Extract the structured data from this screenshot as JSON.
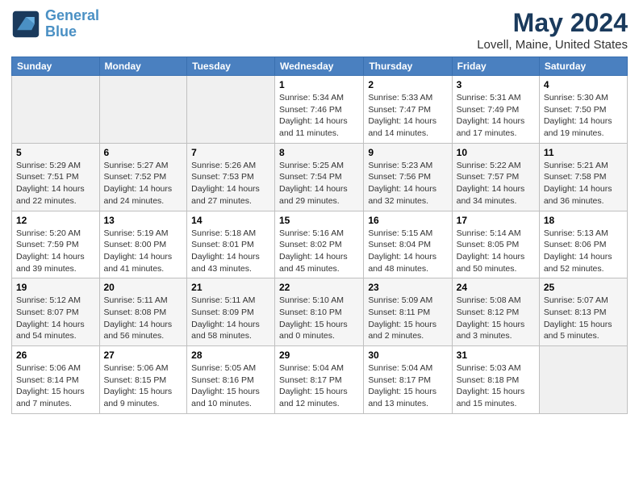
{
  "logo": {
    "line1": "General",
    "line2": "Blue"
  },
  "title": "May 2024",
  "location": "Lovell, Maine, United States",
  "weekdays": [
    "Sunday",
    "Monday",
    "Tuesday",
    "Wednesday",
    "Thursday",
    "Friday",
    "Saturday"
  ],
  "weeks": [
    [
      {
        "day": "",
        "empty": true
      },
      {
        "day": "",
        "empty": true
      },
      {
        "day": "",
        "empty": true
      },
      {
        "day": "1",
        "sunrise": "5:34 AM",
        "sunset": "7:46 PM",
        "daylight": "14 hours and 11 minutes."
      },
      {
        "day": "2",
        "sunrise": "5:33 AM",
        "sunset": "7:47 PM",
        "daylight": "14 hours and 14 minutes."
      },
      {
        "day": "3",
        "sunrise": "5:31 AM",
        "sunset": "7:49 PM",
        "daylight": "14 hours and 17 minutes."
      },
      {
        "day": "4",
        "sunrise": "5:30 AM",
        "sunset": "7:50 PM",
        "daylight": "14 hours and 19 minutes."
      }
    ],
    [
      {
        "day": "5",
        "sunrise": "5:29 AM",
        "sunset": "7:51 PM",
        "daylight": "14 hours and 22 minutes."
      },
      {
        "day": "6",
        "sunrise": "5:27 AM",
        "sunset": "7:52 PM",
        "daylight": "14 hours and 24 minutes."
      },
      {
        "day": "7",
        "sunrise": "5:26 AM",
        "sunset": "7:53 PM",
        "daylight": "14 hours and 27 minutes."
      },
      {
        "day": "8",
        "sunrise": "5:25 AM",
        "sunset": "7:54 PM",
        "daylight": "14 hours and 29 minutes."
      },
      {
        "day": "9",
        "sunrise": "5:23 AM",
        "sunset": "7:56 PM",
        "daylight": "14 hours and 32 minutes."
      },
      {
        "day": "10",
        "sunrise": "5:22 AM",
        "sunset": "7:57 PM",
        "daylight": "14 hours and 34 minutes."
      },
      {
        "day": "11",
        "sunrise": "5:21 AM",
        "sunset": "7:58 PM",
        "daylight": "14 hours and 36 minutes."
      }
    ],
    [
      {
        "day": "12",
        "sunrise": "5:20 AM",
        "sunset": "7:59 PM",
        "daylight": "14 hours and 39 minutes."
      },
      {
        "day": "13",
        "sunrise": "5:19 AM",
        "sunset": "8:00 PM",
        "daylight": "14 hours and 41 minutes."
      },
      {
        "day": "14",
        "sunrise": "5:18 AM",
        "sunset": "8:01 PM",
        "daylight": "14 hours and 43 minutes."
      },
      {
        "day": "15",
        "sunrise": "5:16 AM",
        "sunset": "8:02 PM",
        "daylight": "14 hours and 45 minutes."
      },
      {
        "day": "16",
        "sunrise": "5:15 AM",
        "sunset": "8:04 PM",
        "daylight": "14 hours and 48 minutes."
      },
      {
        "day": "17",
        "sunrise": "5:14 AM",
        "sunset": "8:05 PM",
        "daylight": "14 hours and 50 minutes."
      },
      {
        "day": "18",
        "sunrise": "5:13 AM",
        "sunset": "8:06 PM",
        "daylight": "14 hours and 52 minutes."
      }
    ],
    [
      {
        "day": "19",
        "sunrise": "5:12 AM",
        "sunset": "8:07 PM",
        "daylight": "14 hours and 54 minutes."
      },
      {
        "day": "20",
        "sunrise": "5:11 AM",
        "sunset": "8:08 PM",
        "daylight": "14 hours and 56 minutes."
      },
      {
        "day": "21",
        "sunrise": "5:11 AM",
        "sunset": "8:09 PM",
        "daylight": "14 hours and 58 minutes."
      },
      {
        "day": "22",
        "sunrise": "5:10 AM",
        "sunset": "8:10 PM",
        "daylight": "15 hours and 0 minutes."
      },
      {
        "day": "23",
        "sunrise": "5:09 AM",
        "sunset": "8:11 PM",
        "daylight": "15 hours and 2 minutes."
      },
      {
        "day": "24",
        "sunrise": "5:08 AM",
        "sunset": "8:12 PM",
        "daylight": "15 hours and 3 minutes."
      },
      {
        "day": "25",
        "sunrise": "5:07 AM",
        "sunset": "8:13 PM",
        "daylight": "15 hours and 5 minutes."
      }
    ],
    [
      {
        "day": "26",
        "sunrise": "5:06 AM",
        "sunset": "8:14 PM",
        "daylight": "15 hours and 7 minutes."
      },
      {
        "day": "27",
        "sunrise": "5:06 AM",
        "sunset": "8:15 PM",
        "daylight": "15 hours and 9 minutes."
      },
      {
        "day": "28",
        "sunrise": "5:05 AM",
        "sunset": "8:16 PM",
        "daylight": "15 hours and 10 minutes."
      },
      {
        "day": "29",
        "sunrise": "5:04 AM",
        "sunset": "8:17 PM",
        "daylight": "15 hours and 12 minutes."
      },
      {
        "day": "30",
        "sunrise": "5:04 AM",
        "sunset": "8:17 PM",
        "daylight": "15 hours and 13 minutes."
      },
      {
        "day": "31",
        "sunrise": "5:03 AM",
        "sunset": "8:18 PM",
        "daylight": "15 hours and 15 minutes."
      },
      {
        "day": "",
        "empty": true
      }
    ]
  ],
  "labels": {
    "sunrise_prefix": "Sunrise: ",
    "sunset_prefix": "Sunset: ",
    "daylight_prefix": "Daylight: "
  }
}
